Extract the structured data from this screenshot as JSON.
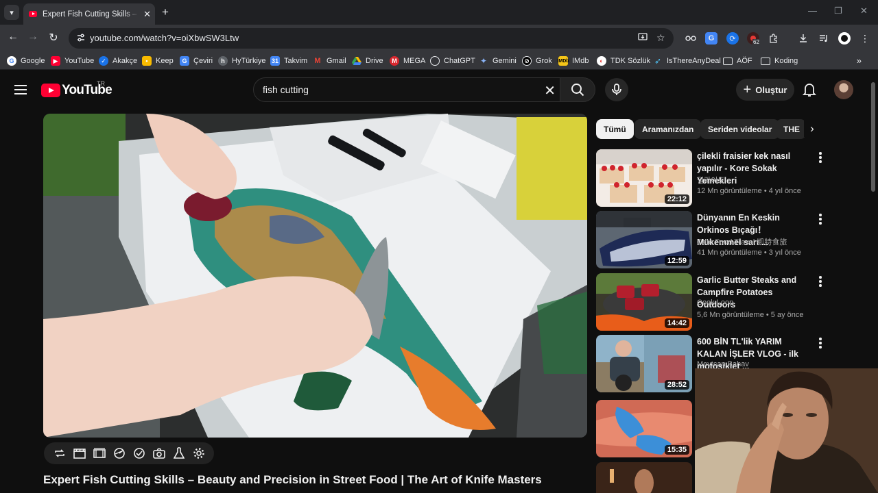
{
  "browser": {
    "tab_title": "Expert Fish Cutting Skills – Beauty and Precision in Street Food | The Art of Knife Masters",
    "url": "youtube.com/watch?v=oiXbwSW3Ltw",
    "extension_badge": "62",
    "bookmarks": [
      {
        "label": "Google",
        "color": "#ffffff"
      },
      {
        "label": "YouTube",
        "color": "#ff0033"
      },
      {
        "label": "Akakçe",
        "color": "#1a73e8"
      },
      {
        "label": "Keep",
        "color": "#f9bb00"
      },
      {
        "label": "Çeviri",
        "color": "#4285f4"
      },
      {
        "label": "HyTürkiye",
        "color": "#5f6368"
      },
      {
        "label": "Takvim",
        "color": "#4285f4"
      },
      {
        "label": "Gmail",
        "color": "#ea4335"
      },
      {
        "label": "Drive",
        "color": "#34a853"
      },
      {
        "label": "MEGA",
        "color": "#d9272e"
      },
      {
        "label": "ChatGPT",
        "color": "#e8eaed"
      },
      {
        "label": "Gemini",
        "color": "#8ab4f8"
      },
      {
        "label": "Grok",
        "color": "#e8eaed"
      },
      {
        "label": "IMdb",
        "color": "#f5c518"
      },
      {
        "label": "TDK Sözlük",
        "color": "#e53935"
      },
      {
        "label": "IsThereAnyDeal",
        "color": "#4fc3f7"
      },
      {
        "label": "AÖF",
        "color": "folder"
      },
      {
        "label": "Koding",
        "color": "folder"
      }
    ]
  },
  "masthead": {
    "logo_text": "YouTube",
    "country_code": "TR",
    "search_query": "fish cutting",
    "create_label": "Oluştur"
  },
  "video": {
    "title": "Expert Fish Cutting Skills – Beauty and Precision in Street Food | The Art of Knife Masters"
  },
  "chips": [
    {
      "label": "Tümü",
      "active": true
    },
    {
      "label": "Aramanızdan",
      "active": false
    },
    {
      "label": "Seriden videolar",
      "active": false
    },
    {
      "label": "THE",
      "active": false
    }
  ],
  "recommendations": [
    {
      "title": "çilekli fraisier kek nasıl yapılır - Kore Sokak Yemekleri",
      "channel": "딜라이트",
      "meta": "12 Mn görüntüleme • 4 yıl önce",
      "duration": "22:12"
    },
    {
      "title": "Dünyanın En Keskin Orkinos Bıçağı！ Mükemmel sarı ...",
      "channel": "Cate Food Travel 凱特食旅",
      "meta": "41 Mn görüntüleme • 3 yıl önce",
      "duration": "12:59"
    },
    {
      "title": "Garlic Butter Steaks and Campfire Potatoes Outdoors",
      "channel": "Cook Loop",
      "meta": "5,6 Mn görüntüleme • 5 ay önce",
      "duration": "14:42"
    },
    {
      "title": "600 BİN TL'lik YARIM KALAN İŞLER VLOG - ilk motosiklet ...",
      "channel": "Mevtcan Bahav",
      "meta": "",
      "duration": "28:52"
    },
    {
      "title": "",
      "channel": "",
      "meta": "",
      "duration": "15:35"
    }
  ],
  "icons": {
    "colors": {
      "accent": "#ff0033",
      "background": "#0f0f0f",
      "chip": "#272727",
      "muted": "#aaaaaa"
    }
  }
}
